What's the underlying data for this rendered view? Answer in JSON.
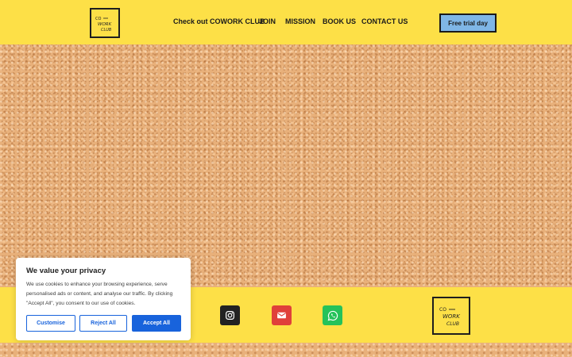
{
  "header": {
    "logo_alt": "CO WORK CLUB",
    "nav": [
      {
        "label": "Check out COWORK CLUB"
      },
      {
        "label": "JOIN"
      },
      {
        "label": "MISSION"
      },
      {
        "label": "BOOK US"
      },
      {
        "label": "CONTACT US"
      }
    ],
    "cta_label": "Free trial day"
  },
  "footer": {
    "social": [
      {
        "icon": "instagram-icon"
      },
      {
        "icon": "email-icon"
      },
      {
        "icon": "whatsapp-icon"
      }
    ]
  },
  "cookie_banner": {
    "title": "We value your privacy",
    "text": "We use cookies to enhance your browsing experience, serve personalised ads or content, and analyse our traffic. By clicking \"Accept All\", you consent to our use of cookies.",
    "customise_label": "Customise",
    "reject_label": "Reject All",
    "accept_label": "Accept All"
  },
  "colors": {
    "brand_yellow": "#fde047",
    "cta_blue": "#7fb6e6",
    "cookie_blue": "#1863dc"
  }
}
